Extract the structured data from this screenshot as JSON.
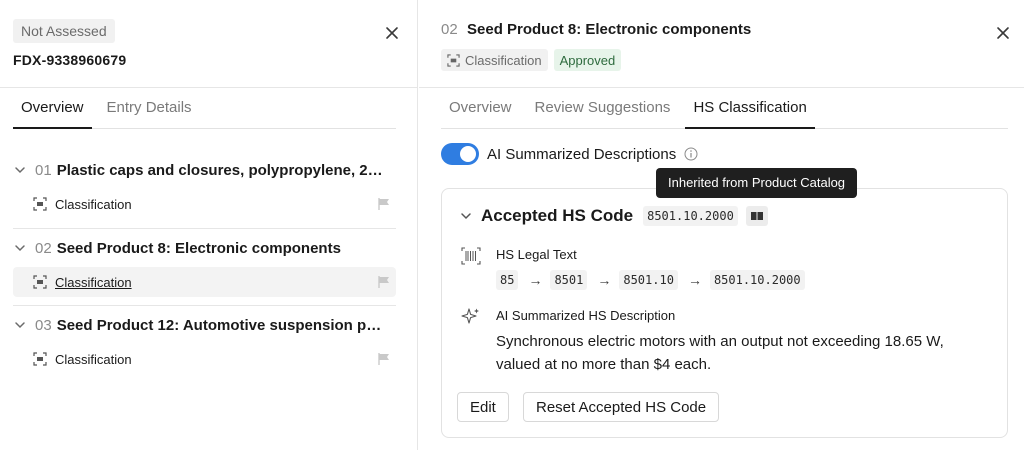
{
  "left": {
    "status": "Not Assessed",
    "reference_id": "FDX-9338960679",
    "tabs": [
      {
        "label": "Overview",
        "active": true
      },
      {
        "label": "Entry Details",
        "active": false
      }
    ],
    "entries": [
      {
        "number": "01",
        "title": "Plastic caps and closures, polypropylene, 28...",
        "row_label": "Classification",
        "selected": false
      },
      {
        "number": "02",
        "title": "Seed Product 8: Electronic components",
        "row_label": "Classification",
        "selected": true
      },
      {
        "number": "03",
        "title": "Seed Product 12: Automotive suspension par...",
        "row_label": "Classification",
        "selected": false
      }
    ]
  },
  "right": {
    "number": "02",
    "title": "Seed Product 8: Electronic components",
    "chips": {
      "classification": "Classification",
      "status": "Approved"
    },
    "tabs": [
      {
        "label": "Overview",
        "active": false
      },
      {
        "label": "Review Suggestions",
        "active": false
      },
      {
        "label": "HS Classification",
        "active": true
      }
    ],
    "toggle": {
      "label": "AI Summarized Descriptions",
      "on": true
    },
    "tooltip": "Inherited from Product Catalog",
    "card": {
      "title": "Accepted HS Code",
      "code": "8501.10.2000",
      "legal_text_title": "HS Legal Text",
      "path": [
        "85",
        "8501",
        "8501.10",
        "8501.10.2000"
      ],
      "ai_title": "AI Summarized HS Description",
      "description": "Synchronous electric motors with an output not exceeding 18.65 W, valued at no more than $4 each.",
      "edit_label": "Edit",
      "reset_label": "Reset Accepted HS Code"
    }
  },
  "colors": {
    "accent": "#2f7de1",
    "approved_bg": "#e7f4ea",
    "approved_text": "#2e6b3e"
  }
}
